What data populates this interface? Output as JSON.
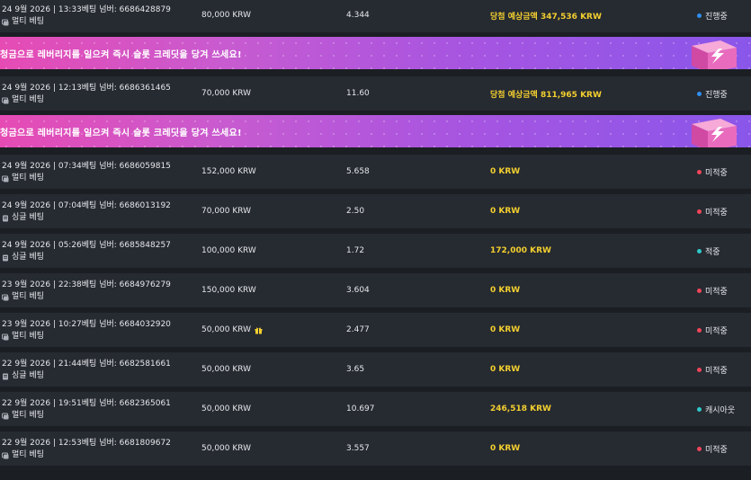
{
  "colors": {
    "payout_yellow": "#f3cf2f",
    "status_progress": "#2e8ff0",
    "status_miss": "#f0455a",
    "status_hit": "#2ec9c9"
  },
  "bets": [
    {
      "info": "24 9월 2026 | 13:33베팅 넘버: 6686428879",
      "type": "멀티 베팅",
      "type_icon": "multi-bet-icon",
      "stake": "80,000 KRW",
      "odds": "4.344",
      "payout": "당첨 예상금액 347,536 KRW",
      "status": "진행중",
      "status_color": "#2e8ff0"
    },
    {
      "info": "24 9월 2026 | 12:13베팅 넘버: 6686361465",
      "type": "멀티 베팅",
      "type_icon": "multi-bet-icon",
      "stake": "70,000 KRW",
      "odds": "11.60",
      "payout": "당첨 예상금액 811,965 KRW",
      "status": "진행중",
      "status_color": "#2e8ff0"
    },
    {
      "info": "24 9월 2026 | 07:34베팅 넘버: 6686059815",
      "type": "멀티 베팅",
      "type_icon": "multi-bet-icon",
      "stake": "152,000 KRW",
      "odds": "5.658",
      "payout": "0 KRW",
      "status": "미적중",
      "status_color": "#f0455a"
    },
    {
      "info": "24 9월 2026 | 07:04베팅 넘버: 6686013192",
      "type": "싱글 베팅",
      "type_icon": "single-bet-icon",
      "stake": "70,000 KRW",
      "odds": "2.50",
      "payout": "0 KRW",
      "status": "미적중",
      "status_color": "#f0455a"
    },
    {
      "info": "24 9월 2026 | 05:26베팅 넘버: 6685848257",
      "type": "싱글 베팅",
      "type_icon": "single-bet-icon",
      "stake": "100,000 KRW",
      "odds": "1.72",
      "payout": "172,000 KRW",
      "status": "적중",
      "status_color": "#2ec9c9"
    },
    {
      "info": "23 9월 2026 | 22:38베팅 넘버: 6684976279",
      "type": "멀티 베팅",
      "type_icon": "multi-bet-icon",
      "stake": "150,000 KRW",
      "odds": "3.604",
      "payout": "0 KRW",
      "status": "미적중",
      "status_color": "#f0455a"
    },
    {
      "info": "23 9월 2026 | 10:27베팅 넘버: 6684032920",
      "type": "멀티 베팅",
      "type_icon": "multi-bet-icon",
      "stake": "50,000 KRW",
      "odds": "2.477",
      "payout": "0 KRW",
      "status": "미적중",
      "status_color": "#f0455a",
      "gift": true
    },
    {
      "info": "22 9월 2026 | 21:44베팅 넘버: 6682581661",
      "type": "싱글 베팅",
      "type_icon": "single-bet-icon",
      "stake": "50,000 KRW",
      "odds": "3.65",
      "payout": "0 KRW",
      "status": "미적중",
      "status_color": "#f0455a"
    },
    {
      "info": "22 9월 2026 | 19:51베팅 넘버: 6682365061",
      "type": "멀티 베팅",
      "type_icon": "multi-bet-icon",
      "stake": "50,000 KRW",
      "odds": "10.697",
      "payout": "246,518 KRW",
      "status": "캐시아웃",
      "status_color": "#2ec9c9"
    },
    {
      "info": "22 9월 2026 | 12:53베팅 넘버: 6681809672",
      "type": "멀티 베팅",
      "type_icon": "multi-bet-icon",
      "stake": "50,000 KRW",
      "odds": "3.557",
      "payout": "0 KRW",
      "status": "미적중",
      "status_color": "#f0455a"
    }
  ],
  "banner": {
    "text": "청금으로 레버리지를 일으켜 즉시 슬롯 크레딧을 당겨 쓰세요!",
    "icon": "lightning-box-icon"
  }
}
